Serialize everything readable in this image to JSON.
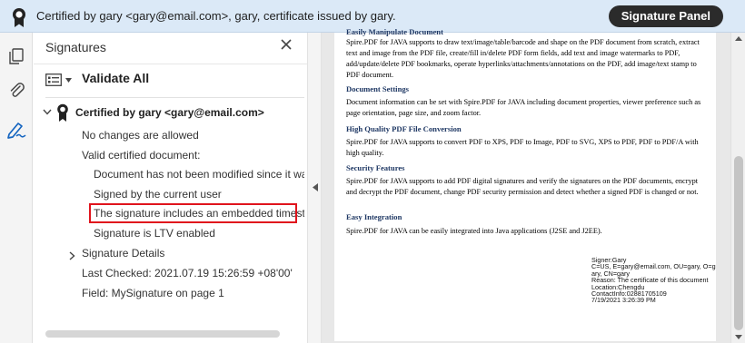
{
  "cert_bar": {
    "message": "Certified by gary <gary@email.com>, gary, certificate issued by gary.",
    "signature_panel_button": "Signature Panel"
  },
  "rail": {
    "tools": [
      "pages-icon",
      "attachment-icon",
      "signature-pen-icon"
    ],
    "active": "signature-pen-icon"
  },
  "panel": {
    "title": "Signatures",
    "validate_all": "Validate All",
    "signature": {
      "label": "Certified by gary <gary@email.com>",
      "items": [
        "No changes are allowed",
        "Valid certified document:",
        "Document has not been modified since it was certified",
        "Signed by the current user",
        "The signature includes an embedded timestamp.",
        "Signature is LTV enabled",
        "Signature Details",
        "Last Checked: 2021.07.19 15:26:59 +08'00'",
        "Field: MySignature on page 1"
      ]
    }
  },
  "document": {
    "sections": [
      {
        "heading": "Easily Manipulate Document",
        "body": "Spire.PDF for JAVA supports to draw text/image/table/barcode and shape on the PDF document from scratch, extract text and image from the PDF file, create/fill in/delete PDF form fields, add text and image watermarks to PDF, add/update/delete PDF bookmarks, operate hyperlinks/attachments/annotations on the PDF, add image/text stamp to PDF document."
      },
      {
        "heading": "Document Settings",
        "body": "Document information can be set with Spire.PDF for JAVA including document properties, viewer preference such as page orientation, page size, and zoom factor."
      },
      {
        "heading": "High Quality PDF File Conversion",
        "body": "Spire.PDF for JAVA supports to convert PDF to XPS, PDF to Image, PDF to SVG, XPS to PDF, PDF to PDF/A with high quality."
      },
      {
        "heading": "Security Features",
        "body": "Spire.PDF for JAVA supports to add PDF digital signatures and verify the signatures on the PDF documents, encrypt and decrypt the PDF document, change PDF security permission and detect whether a signed PDF is changed or not."
      },
      {
        "heading": "Easy Integration",
        "body": "Spire.PDF for JAVA can be easily integrated into Java applications (J2SE and J2EE)."
      }
    ],
    "signature_stamp": [
      "Signer:Gary",
      "C=US, E=gary@email.com, OU=gary, O=g",
      "ary, CN=gary",
      "Reason: The certificate of this document",
      "Location:Chengdu",
      "ContactInfo:02881705109",
      "7/19/2021 3:26:39 PM"
    ]
  },
  "colors": {
    "cert_bar_bg": "#dbe9f7",
    "heading_blue": "#1f3864",
    "highlight_red": "#e0141d"
  }
}
